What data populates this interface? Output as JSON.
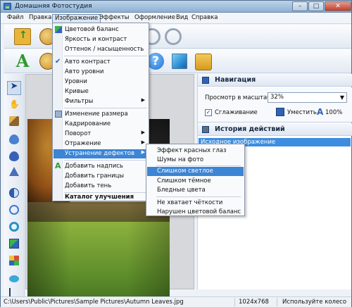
{
  "window": {
    "title": "Домашняя Фотостудия",
    "minimize": "–",
    "maximize": "□",
    "close": "✕"
  },
  "menubar": [
    "Файл",
    "Правка",
    "Изображение",
    "Эффекты",
    "Оформление",
    "Вид",
    "Справка"
  ],
  "image_menu": {
    "items": [
      "Цветовой баланс",
      "Яркость и контраст",
      "Оттенок / насыщенность",
      "Авто контраст",
      "Авто уровни",
      "Уровни",
      "Кривые",
      "Фильтры",
      "Изменение размера",
      "Кадрирование",
      "Поворот",
      "Отражение",
      "Устранение дефектов",
      "Добавить надпись",
      "Добавить границы",
      "Добавить тень",
      "Каталог улучшения"
    ],
    "highlighted": "Устранение дефектов"
  },
  "defects_submenu": {
    "items": [
      "Эффект красных глаз",
      "Шумы на фото",
      "Слишком светлое",
      "Слишком тёмное",
      "Бледные цвета",
      "Не хватает чёткости",
      "Нарушен цветовой баланс"
    ],
    "highlighted": "Слишком светлое"
  },
  "navigation": {
    "title": "Навигация",
    "zoom_label": "Просмотр в масштабе",
    "zoom_value": "32%",
    "smoothing_label": "Сглаживание",
    "smoothing_checked": true,
    "fit_label": "Уместить",
    "actual_label": "100%"
  },
  "history": {
    "title": "История действий",
    "entries": [
      "Исходное изображение"
    ]
  },
  "statusbar": {
    "path": "C:\\Users\\Public\\Pictures\\Sample Pictures\\Autumn Leaves.jpg",
    "dimensions": "1024x768",
    "hint": "Используйте колесо"
  },
  "colors": {
    "menu_highlight": "#3c84d4",
    "title_gradient_top": "#bcd3ea",
    "title_gradient_bottom": "#8fb1d3"
  }
}
